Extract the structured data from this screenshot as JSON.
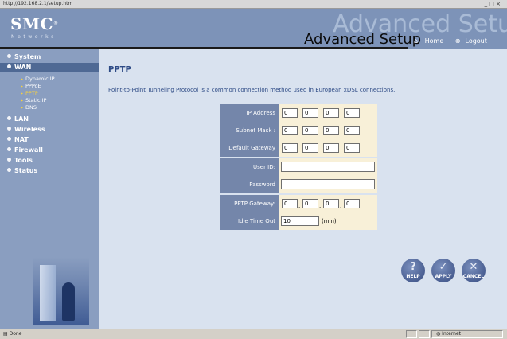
{
  "browser": {
    "address": "http://192.168.2.1/setup.htm",
    "window_controls": "_ □ ×",
    "status_text": "Done",
    "zone_text": "Internet"
  },
  "header": {
    "logo": "SMC",
    "logo_mark": "®",
    "networks": "Networks",
    "big_title": "Advanced Setup",
    "small_title": "Advanced Setup",
    "home_link": "Home",
    "logout_link": "Logout"
  },
  "sidebar": {
    "items": [
      {
        "label": "System"
      },
      {
        "label": "WAN"
      },
      {
        "label": "LAN"
      },
      {
        "label": "Wireless"
      },
      {
        "label": "NAT"
      },
      {
        "label": "Firewall"
      },
      {
        "label": "Tools"
      },
      {
        "label": "Status"
      }
    ],
    "wan_sub": [
      {
        "label": "Dynamic IP"
      },
      {
        "label": "PPPoE"
      },
      {
        "label": "PPTP"
      },
      {
        "label": "Static IP"
      },
      {
        "label": "DNS"
      }
    ]
  },
  "main": {
    "title": "PPTP",
    "description": "Point-to-Point Tunneling Protocol is a common connection method used in European xDSL connections.",
    "fields": {
      "ip_address": {
        "label": "IP Address",
        "values": [
          "0",
          "0",
          "0",
          "0"
        ]
      },
      "subnet_mask": {
        "label": "Subnet Mask :",
        "values": [
          "0",
          "0",
          "0",
          "0"
        ]
      },
      "default_gateway": {
        "label": "Default Gateway",
        "values": [
          "0",
          "0",
          "0",
          "0"
        ]
      },
      "user_id": {
        "label": "User ID:",
        "value": ""
      },
      "password": {
        "label": "Password",
        "value": ""
      },
      "pptp_gateway": {
        "label": "PPTP Gateway:",
        "values": [
          "0",
          "0",
          "0",
          "0"
        ]
      },
      "idle_time": {
        "label": "Idle Time Out",
        "value": "10",
        "unit": "(min)"
      }
    },
    "buttons": {
      "help": "HELP",
      "apply": "APPLY",
      "cancel": "CANCEL"
    }
  },
  "colors": {
    "header_bg": "#7d93b8",
    "sidebar_bg": "#8a9ec0",
    "main_bg": "#d9e2ef",
    "label_bg": "#7486aa",
    "field_bg": "#f8f0d8",
    "title_color": "#2d4a85"
  }
}
